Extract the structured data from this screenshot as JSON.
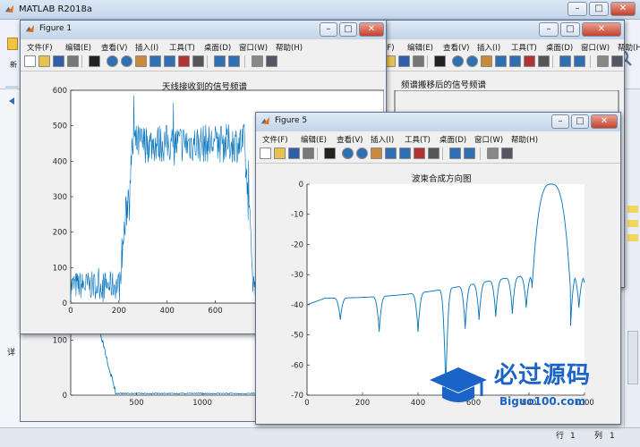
{
  "main_window": {
    "title": "MATLAB R2018a",
    "logo_icon": "matlab-logo-icon",
    "ribbon_new_label": "新",
    "side_label": "详",
    "status_row_label": "行",
    "status_row_value": "1",
    "status_col_label": "列",
    "status_col_value": "1"
  },
  "menus": [
    "文件(F)",
    "编辑(E)",
    "查看(V)",
    "插入(I)",
    "工具(T)",
    "桌面(D)",
    "窗口(W)",
    "帮助(H)"
  ],
  "toolbar_icons": [
    "new-figure-icon",
    "open-icon",
    "save-icon",
    "print-icon",
    "pointer-icon",
    "zoom-in-icon",
    "zoom-out-icon",
    "pan-icon",
    "rotate-icon",
    "data-cursor-icon",
    "brush-icon",
    "link-icon",
    "colorbar-icon",
    "legend-icon",
    "hide-plot-tools-icon",
    "show-plot-tools-icon"
  ],
  "figure_back": {
    "title": "频谱搬移后的信号频谱"
  },
  "figure1": {
    "window_title": "Figure 1",
    "axes_title": "天线接收到的信号频谱"
  },
  "figure5": {
    "window_title": "Figure 5",
    "axes_title": "波束合成方向图"
  },
  "watermark": {
    "brand": "必过源码",
    "site": "Biguo100.com"
  },
  "chart_data": [
    {
      "type": "line",
      "id": "fig1",
      "title": "天线接收到的信号频谱",
      "x_ticks": [
        0,
        200,
        400,
        600,
        800,
        1000,
        1200
      ],
      "y_ticks": [
        0,
        100,
        200,
        300,
        400,
        500,
        600
      ],
      "xlim": [
        0,
        1300
      ],
      "ylim": [
        0,
        600
      ],
      "segments": [
        {
          "x_from": 0,
          "x_to": 200,
          "level": 50,
          "noise": 40
        },
        {
          "x_from": 200,
          "x_to": 260,
          "level": 250,
          "ramp": true
        },
        {
          "x_from": 260,
          "x_to": 720,
          "level": 450,
          "noise": 55
        },
        {
          "x_from": 720,
          "x_to": 760,
          "level": 250,
          "ramp": true
        },
        {
          "x_from": 760,
          "x_to": 1210,
          "level": 50,
          "noise": 40
        },
        {
          "x_from": 1210,
          "x_to": 1260,
          "level": 250,
          "ramp": true
        },
        {
          "x_from": 1260,
          "x_to": 1300,
          "level": 450,
          "noise": 55
        }
      ],
      "color": "#0072bd"
    },
    {
      "type": "line",
      "id": "fig5",
      "title": "波束合成方向图",
      "x_ticks": [
        0,
        200,
        400,
        600,
        800,
        1000
      ],
      "y_ticks": [
        0,
        -10,
        -20,
        -30,
        -40,
        -50,
        -60,
        -70
      ],
      "xlim": [
        0,
        1000
      ],
      "ylim": [
        -70,
        0
      ],
      "main_lobe_center": 880,
      "color": "#0072bd"
    },
    {
      "type": "line",
      "id": "fig-bottom",
      "x_ticks": [
        500,
        1000,
        1500
      ],
      "y_ticks": [
        0,
        100
      ],
      "xlim": [
        0,
        1700
      ],
      "ylim": [
        0,
        150
      ],
      "color": "#0072bd"
    }
  ]
}
